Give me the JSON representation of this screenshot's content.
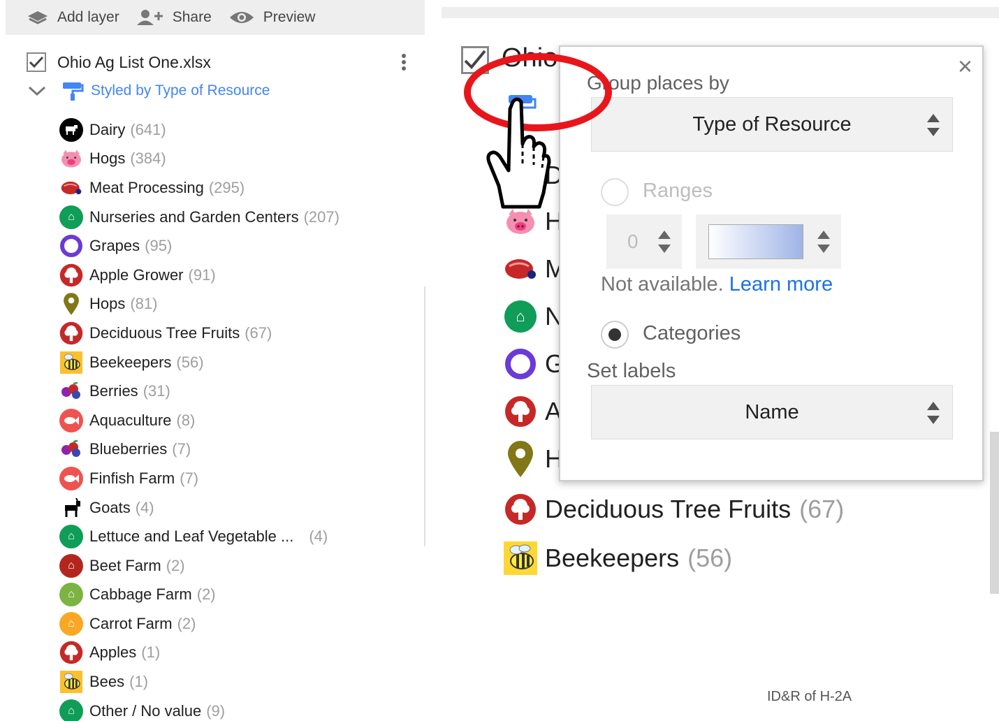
{
  "toolbar": {
    "add_layer": "Add layer",
    "share": "Share",
    "preview": "Preview"
  },
  "layer": {
    "title": "Ohio Ag List One.xlsx",
    "style_label": "Styled by Type of Resource"
  },
  "categories": [
    {
      "name": "Dairy",
      "count": "(641)",
      "icon": "cow-icon",
      "color": "#000000"
    },
    {
      "name": "Hogs",
      "count": "(384)",
      "icon": "pig-icon",
      "color": "#f48fb1"
    },
    {
      "name": "Meat Processing",
      "count": "(295)",
      "icon": "meat-icon",
      "color": "#c62828"
    },
    {
      "name": "Nurseries and Garden Centers",
      "count": "(207)",
      "icon": "farm-icon",
      "color": "#0f9d58"
    },
    {
      "name": "Grapes",
      "count": "(95)",
      "icon": "ring-icon",
      "color": "#6a3bd6"
    },
    {
      "name": "Apple Grower",
      "count": "(91)",
      "icon": "tree-icon",
      "color": "#c62828"
    },
    {
      "name": "Hops",
      "count": "(81)",
      "icon": "pin-icon",
      "color": "#827717"
    },
    {
      "name": "Deciduous Tree Fruits",
      "count": "(67)",
      "icon": "tree-icon",
      "color": "#c62828"
    },
    {
      "name": "Beekeepers",
      "count": "(56)",
      "icon": "bee-icon",
      "color": "#fbc02d"
    },
    {
      "name": "Berries",
      "count": "(31)",
      "icon": "berries-icon",
      "color": "#8e24aa"
    },
    {
      "name": "Aquaculture",
      "count": "(8)",
      "icon": "fish-icon",
      "color": "#ef5350"
    },
    {
      "name": "Blueberries",
      "count": "(7)",
      "icon": "berries-icon",
      "color": "#8e24aa"
    },
    {
      "name": "Finfish Farm",
      "count": "(7)",
      "icon": "fish-icon",
      "color": "#ef5350"
    },
    {
      "name": "Goats",
      "count": "(4)",
      "icon": "goat-icon",
      "color": "#000000"
    },
    {
      "name": "Lettuce and Leaf Vegetable ...",
      "count": "(4)",
      "icon": "farm-icon",
      "color": "#0f9d58"
    },
    {
      "name": "Beet Farm",
      "count": "(2)",
      "icon": "farm-icon",
      "color": "#b3261e"
    },
    {
      "name": "Cabbage Farm",
      "count": "(2)",
      "icon": "farm-icon",
      "color": "#7cb342"
    },
    {
      "name": "Carrot Farm",
      "count": "(2)",
      "icon": "farm-icon",
      "color": "#f9a825"
    },
    {
      "name": "Apples",
      "count": "(1)",
      "icon": "tree-icon",
      "color": "#c62828"
    },
    {
      "name": "Bees",
      "count": "(1)",
      "icon": "bee-icon",
      "color": "#fbc02d"
    },
    {
      "name": "Other / No value",
      "count": "(9)",
      "icon": "farm-icon",
      "color": "#0f9d58"
    }
  ],
  "zoom": {
    "title_fragment": "Ohio",
    "rows": [
      {
        "letter": "D"
      },
      {
        "letter": "H"
      },
      {
        "letter": "M"
      },
      {
        "letter": "N"
      },
      {
        "letter": "G"
      },
      {
        "letter": "A"
      },
      {
        "letter": "H"
      }
    ],
    "full_rows": [
      {
        "name": "Deciduous Tree Fruits",
        "count": "(67)"
      },
      {
        "name": "Beekeepers",
        "count": "(56)"
      }
    ]
  },
  "popup": {
    "group_label": "Group places by",
    "group_value": "Type of Resource",
    "ranges_label": "Ranges",
    "range_number": "0",
    "not_available": "Not available.",
    "learn_more": "Learn more",
    "categories_label": "Categories",
    "set_labels": "Set labels",
    "label_value": "Name",
    "close_glyph": "×"
  },
  "footer": "ID&R of H-2A",
  "colors": {
    "accent": "#4285f4",
    "link": "#1a73e8",
    "highlight_ring": "#e8161b"
  }
}
